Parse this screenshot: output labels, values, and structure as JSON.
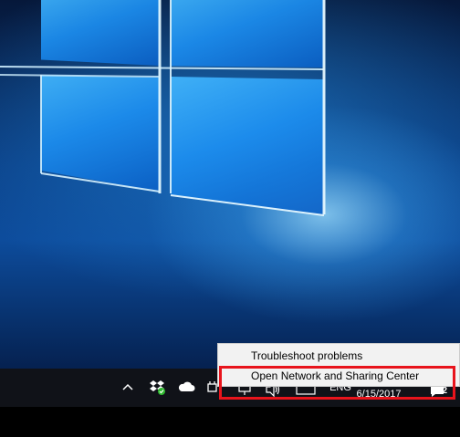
{
  "context_menu": {
    "items": [
      {
        "label": "Troubleshoot problems"
      },
      {
        "label": "Open Network and Sharing Center"
      }
    ]
  },
  "taskbar": {
    "tray": {
      "show_hidden_icon": "chevron-up-icon",
      "date": "6/15/2017",
      "language": "ENG",
      "notification_count": "2"
    }
  },
  "colors": {
    "highlight": "#e8141c",
    "taskbar": "#101218",
    "menu_background": "#f2f2f2"
  }
}
